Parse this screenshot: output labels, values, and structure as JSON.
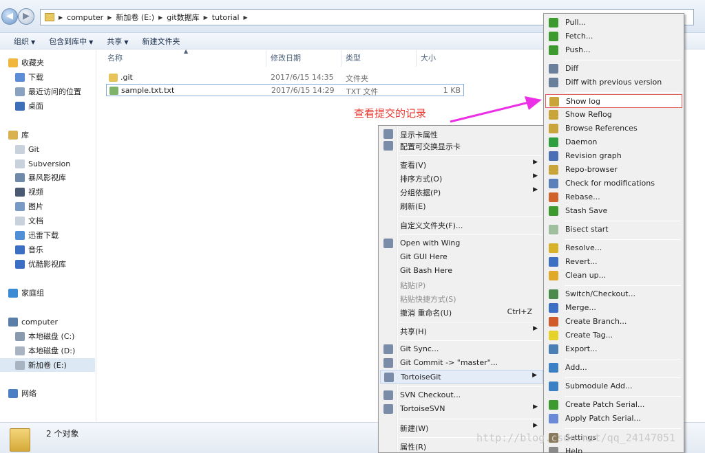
{
  "address": {
    "back_icon": "back-arrow-icon",
    "crumbs": [
      "computer",
      "新加卷 (E:)",
      "git数据库",
      "tutorial"
    ]
  },
  "toolbar": [
    "组织",
    "包含到库中",
    "共享",
    "新建文件夹"
  ],
  "nav": {
    "favorites": {
      "label": "收藏夹",
      "items": [
        "下载",
        "最近访问的位置",
        "桌面"
      ]
    },
    "libraries": {
      "label": "库",
      "items": [
        "Git",
        "Subversion",
        "暴风影视库",
        "视频",
        "图片",
        "文档",
        "迅雷下载",
        "音乐",
        "优酷影视库"
      ]
    },
    "homegroup": "家庭组",
    "computer": {
      "label": "computer",
      "items": [
        "本地磁盘 (C:)",
        "本地磁盘 (D:)",
        "新加卷 (E:)"
      ]
    },
    "network": "网络"
  },
  "columns": {
    "name": "名称",
    "date": "修改日期",
    "type": "类型",
    "size": "大小"
  },
  "files": [
    {
      "name": ".git",
      "date": "2017/6/15 14:35",
      "type": "文件夹",
      "size": ""
    },
    {
      "name": "sample.txt.txt",
      "date": "2017/6/15 14:29",
      "type": "TXT 文件",
      "size": "1 KB"
    }
  ],
  "status": {
    "count": "2 个对象"
  },
  "annotation": "查看提交的记录",
  "menu_main": {
    "items": [
      {
        "label": "显示卡属性",
        "icon": "display-icon"
      },
      {
        "label": "配置可交换显示卡",
        "icon": "display-switch-icon"
      },
      {
        "sep": true
      },
      {
        "label": "查看(V)",
        "sub": true
      },
      {
        "label": "排序方式(O)",
        "sub": true
      },
      {
        "label": "分组依据(P)",
        "sub": true
      },
      {
        "label": "刷新(E)"
      },
      {
        "sep": true
      },
      {
        "label": "自定义文件夹(F)..."
      },
      {
        "sep": true
      },
      {
        "label": "Open with Wing",
        "icon": "wing-icon"
      },
      {
        "label": "Git GUI Here"
      },
      {
        "label": "Git Bash Here"
      },
      {
        "label": "粘贴(P)",
        "disabled": true
      },
      {
        "label": "粘贴快捷方式(S)",
        "disabled": true
      },
      {
        "label": "撤消 重命名(U)",
        "shortcut": "Ctrl+Z"
      },
      {
        "sep": true
      },
      {
        "label": "共享(H)",
        "sub": true
      },
      {
        "sep": true
      },
      {
        "label": "Git Sync...",
        "icon": "git-sync-icon"
      },
      {
        "label": "Git Commit -> \"master\"...",
        "icon": "git-commit-icon"
      },
      {
        "label": "TortoiseGit",
        "icon": "tortoisegit-icon",
        "sub": true,
        "selected": true
      },
      {
        "sep": true
      },
      {
        "label": "SVN Checkout...",
        "icon": "svn-checkout-icon"
      },
      {
        "label": "TortoiseSVN",
        "icon": "tortoisesvn-icon",
        "sub": true
      },
      {
        "sep": true
      },
      {
        "label": "新建(W)",
        "sub": true
      },
      {
        "sep": true
      },
      {
        "label": "属性(R)"
      }
    ]
  },
  "menu_git": {
    "items": [
      {
        "label": "Pull...",
        "icon": "pull-icon",
        "color": "#3d9a2e"
      },
      {
        "label": "Fetch...",
        "icon": "fetch-icon",
        "color": "#3d9a2e"
      },
      {
        "label": "Push...",
        "icon": "push-icon",
        "color": "#3d9a2e"
      },
      {
        "sep": true
      },
      {
        "label": "Diff",
        "icon": "diff-icon",
        "color": "#6a7f99"
      },
      {
        "label": "Diff with previous version",
        "icon": "diff-prev-icon",
        "color": "#6a7f99"
      },
      {
        "sep": true
      },
      {
        "label": "Show log",
        "icon": "show-log-icon",
        "color": "#c9a43a",
        "highlight": true
      },
      {
        "label": "Show Reflog",
        "icon": "reflog-icon",
        "color": "#c9a43a"
      },
      {
        "label": "Browse References",
        "icon": "browse-refs-icon",
        "color": "#c9a43a"
      },
      {
        "label": "Daemon",
        "icon": "daemon-icon",
        "color": "#2f9e3e"
      },
      {
        "label": "Revision graph",
        "icon": "revision-graph-icon",
        "color": "#4a6fb5"
      },
      {
        "label": "Repo-browser",
        "icon": "repo-browser-icon",
        "color": "#c9a43a"
      },
      {
        "label": "Check for modifications",
        "icon": "check-mods-icon",
        "color": "#5b7fb8"
      },
      {
        "label": "Rebase...",
        "icon": "rebase-icon",
        "color": "#d0632c"
      },
      {
        "label": "Stash Save",
        "icon": "stash-icon",
        "color": "#3d9a2e"
      },
      {
        "sep": true
      },
      {
        "label": "Bisect start",
        "icon": "bisect-icon",
        "color": "#9fbf9f"
      },
      {
        "sep": true
      },
      {
        "label": "Resolve...",
        "icon": "resolve-icon",
        "color": "#d8b12a"
      },
      {
        "label": "Revert...",
        "icon": "revert-icon",
        "color": "#3b6fc4"
      },
      {
        "label": "Clean up...",
        "icon": "cleanup-icon",
        "color": "#e0a92a"
      },
      {
        "sep": true
      },
      {
        "label": "Switch/Checkout...",
        "icon": "switch-icon",
        "color": "#4a8a4a"
      },
      {
        "label": "Merge...",
        "icon": "merge-icon",
        "color": "#3b6fc4"
      },
      {
        "label": "Create Branch...",
        "icon": "branch-icon",
        "color": "#d05a2a"
      },
      {
        "label": "Create Tag...",
        "icon": "tag-icon",
        "color": "#e6d22a"
      },
      {
        "label": "Export...",
        "icon": "export-icon",
        "color": "#4a7fb5"
      },
      {
        "sep": true
      },
      {
        "label": "Add...",
        "icon": "add-icon",
        "color": "#3b7fc4"
      },
      {
        "sep": true
      },
      {
        "label": "Submodule Add...",
        "icon": "submodule-icon",
        "color": "#3b7fc4"
      },
      {
        "sep": true
      },
      {
        "label": "Create Patch Serial...",
        "icon": "patch-icon",
        "color": "#3d9a2e"
      },
      {
        "label": "Apply Patch Serial...",
        "icon": "apply-patch-icon",
        "color": "#6a8ad8"
      },
      {
        "sep": true
      },
      {
        "label": "Settings",
        "icon": "settings-icon",
        "color": "#8a7a5a"
      },
      {
        "label": "Help",
        "icon": "help-icon",
        "color": "#8a8a8a"
      }
    ]
  },
  "watermark": "http://blog.csdn.net/qq_24147051"
}
